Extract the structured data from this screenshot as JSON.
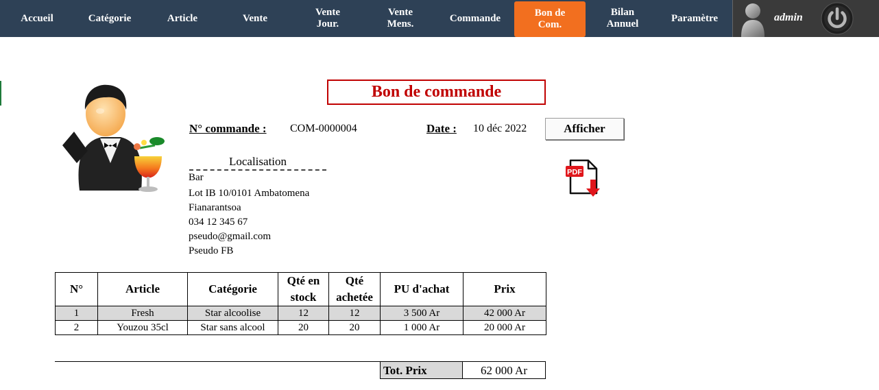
{
  "nav": {
    "items": [
      {
        "line1": "Accueil",
        "line2": ""
      },
      {
        "line1": "Catégorie",
        "line2": ""
      },
      {
        "line1": "Article",
        "line2": ""
      },
      {
        "line1": "Vente",
        "line2": ""
      },
      {
        "line1": "Vente",
        "line2": "Jour."
      },
      {
        "line1": "Vente",
        "line2": "Mens."
      },
      {
        "line1": "Commande",
        "line2": ""
      },
      {
        "line1": "Bon de",
        "line2": "Com."
      },
      {
        "line1": "Bilan",
        "line2": "Annuel"
      },
      {
        "line1": "Paramètre",
        "line2": ""
      }
    ],
    "active_color": "#f26f1f",
    "bar_color": "#2e4156",
    "user": "admin",
    "avatar_icon": "user-silhouette-icon",
    "power_icon": "power-icon"
  },
  "page": {
    "title": "Bon de commande",
    "title_color": "#c00000",
    "illustration": "waiter-with-cocktail"
  },
  "order": {
    "number_label": "N° commande :",
    "number_value": "COM-0000004",
    "date_label": "Date :",
    "date_value": "10 déc 2022",
    "show_button": "Afficher",
    "pdf_icon": "pdf-download-icon"
  },
  "location": {
    "title": "Localisation",
    "lines": [
      "Bar",
      "Lot IB 10/0101 Ambatomena",
      "Fianarantsoa",
      "034 12 345 67",
      "pseudo@gmail.com",
      "Pseudo FB"
    ]
  },
  "table": {
    "headers": [
      {
        "line1": "N°",
        "line2": ""
      },
      {
        "line1": "Article",
        "line2": ""
      },
      {
        "line1": "Catégorie",
        "line2": ""
      },
      {
        "line1": "Qté en",
        "line2": "stock"
      },
      {
        "line1": "Qté",
        "line2": "achetée"
      },
      {
        "line1": "PU d'achat",
        "line2": ""
      },
      {
        "line1": "Prix",
        "line2": ""
      }
    ],
    "rows": [
      [
        "1",
        "Fresh",
        "Star alcoolise",
        "12",
        "12",
        "3 500 Ar",
        "42 000 Ar"
      ],
      [
        "2",
        "Youzou 35cl",
        "Star sans alcool",
        "20",
        "20",
        "1 000 Ar",
        "20 000 Ar"
      ]
    ]
  },
  "total": {
    "label": "Tot. Prix",
    "value": "62 000 Ar"
  }
}
